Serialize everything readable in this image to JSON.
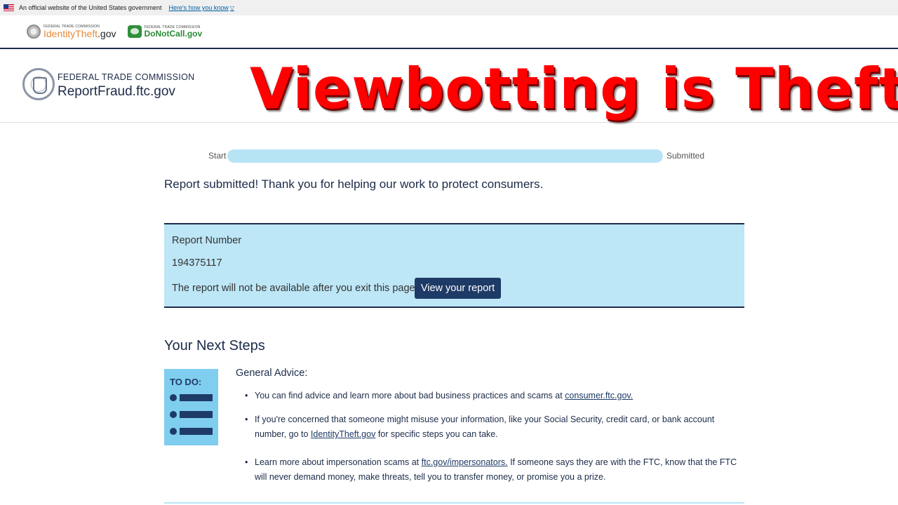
{
  "gov_banner": {
    "text": "An official website of the United States government",
    "link": "Here's how you know"
  },
  "top_logos": {
    "identity_small": "FEDERAL TRADE COMMISSION",
    "identity_part1": "IdentityTheft",
    "identity_part2": ".gov",
    "dnc_small": "FEDERAL TRADE COMMISSION",
    "dnc_name": "DoNotCall.gov"
  },
  "header": {
    "agency": "FEDERAL TRADE COMMISSION",
    "site": "ReportFraud.ftc.gov"
  },
  "overlay": {
    "title": "Viewbotting is Theft",
    "color": "#ff0000"
  },
  "progress": {
    "start_label": "Start",
    "end_label": "Submitted",
    "fraction": 1.0
  },
  "confirmation": "Report submitted! Thank you for helping our work to protect consumers.",
  "report": {
    "label": "Report Number",
    "number": "194375117",
    "note": "The report will not be available after you exit this page.",
    "button": "View your report"
  },
  "next_steps": {
    "heading": "Your Next Steps",
    "todo_label": "TO DO:",
    "general_heading": "General Advice:",
    "items": [
      {
        "text": "You can find advice and learn more about bad business practices and scams at ",
        "link": "consumer.ftc.gov.",
        "after": ""
      },
      {
        "text": "If you're concerned that someone might misuse your information, like your Social Security, credit card, or bank account number, go to ",
        "link": "IdentityTheft.gov",
        "after": " for specific steps you can take."
      },
      {
        "text": "Learn more about impersonation scams at ",
        "link": "ftc.gov/impersonators.",
        "after": " If someone says they are with the FTC, know that the FTC will never demand money, make threats, tell you to transfer money, or promise you a prize."
      }
    ]
  },
  "colors": {
    "navy": "#1b2b48",
    "light_blue": "#bde6f6",
    "button": "#1e3a66",
    "todo_bg": "#7fcdef"
  }
}
